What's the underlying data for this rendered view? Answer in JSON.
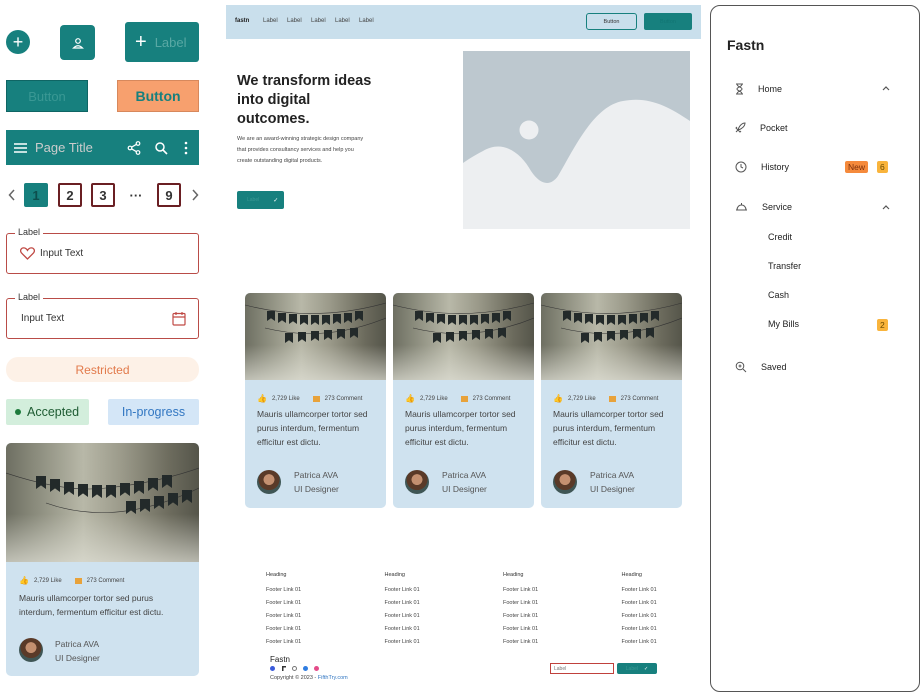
{
  "left": {
    "icon_button_label": "Label",
    "button1_label": "Button",
    "button2_label": "Button",
    "appbar_title": "Page Title",
    "pages": [
      "1",
      "2",
      "3",
      "···",
      "9"
    ],
    "input1": {
      "legend": "Label",
      "value": "Input Text"
    },
    "input2": {
      "legend": "Label",
      "value": "Input Text"
    },
    "chip_restricted": "Restricted",
    "status_accepted": "Accepted",
    "status_inprogress": "In-progress",
    "card": {
      "likes": "2,729 Like",
      "comments": "273 Comment",
      "desc": "Mauris ullamcorper tortor sed purus interdum, fermentum efficitur est dictu.",
      "name": "Patrica AVA",
      "role": "UI Designer"
    }
  },
  "web": {
    "brand": "fastn",
    "nav": [
      "Label",
      "Label",
      "Label",
      "Label",
      "Label"
    ],
    "nav_button": "Button",
    "nav_button2": "Button",
    "hero_title": "We transform ideas into digital outcomes.",
    "hero_text": "We are an award-winning strategic design company that provides consultancy services and help you create outstanding digital products.",
    "hero_cta": "Label",
    "cards": [
      {
        "likes": "2,729 Like",
        "comments": "273 Comment",
        "desc": "Mauris ullamcorper tortor sed purus interdum, fermentum efficitur est dictu.",
        "name": "Patrica AVA",
        "role": "UI Designer"
      },
      {
        "likes": "2,729 Like",
        "comments": "273 Comment",
        "desc": "Mauris ullamcorper tortor sed purus interdum, fermentum efficitur est dictu.",
        "name": "Patrica AVA",
        "role": "UI Designer"
      },
      {
        "likes": "2,729 Like",
        "comments": "273 Comment",
        "desc": "Mauris ullamcorper tortor sed purus interdum, fermentum efficitur est dictu.",
        "name": "Patrica AVA",
        "role": "UI Designer"
      }
    ],
    "footer": {
      "columns": [
        {
          "heading": "Heading",
          "links": [
            "Footer Link 01",
            "Footer Link 01",
            "Footer Link 01",
            "Footer Link 01",
            "Footer Link 01"
          ]
        },
        {
          "heading": "Heading",
          "links": [
            "Footer Link 01",
            "Footer Link 01",
            "Footer Link 01",
            "Footer Link 01",
            "Footer Link 01"
          ]
        },
        {
          "heading": "Heading",
          "links": [
            "Footer Link 01",
            "Footer Link 01",
            "Footer Link 01",
            "Footer Link 01",
            "Footer Link 01"
          ]
        },
        {
          "heading": "Heading",
          "links": [
            "Footer Link 01",
            "Footer Link 01",
            "Footer Link 01",
            "Footer Link 01",
            "Footer Link 01"
          ]
        }
      ],
      "brand": "Fastn",
      "copyright": "Copyright © 2023 - ",
      "copyright_link": "FifthTry.com",
      "input_placeholder": "Label",
      "submit": "Label"
    }
  },
  "sidebar": {
    "title": "Fastn",
    "items": [
      {
        "label": "Home",
        "icon": "hourglass-icon"
      },
      {
        "label": "Pocket",
        "icon": "rocket-icon"
      },
      {
        "label": "History",
        "icon": "clock-icon",
        "badge_new": "New",
        "badge_count": "6"
      },
      {
        "label": "Service",
        "icon": "service-bell-icon"
      },
      {
        "label": "Saved",
        "icon": "zoom-icon"
      }
    ],
    "sub_items": [
      {
        "label": "Credit"
      },
      {
        "label": "Transfer"
      },
      {
        "label": "Cash"
      },
      {
        "label": "My Bills",
        "badge": "2"
      }
    ]
  },
  "colors": {
    "teal": "#17807e",
    "orange": "#f7a06e",
    "card_bg": "#cfe2ef",
    "badge_new": "#f58a3c",
    "badge_yellow": "#f9b43c"
  }
}
